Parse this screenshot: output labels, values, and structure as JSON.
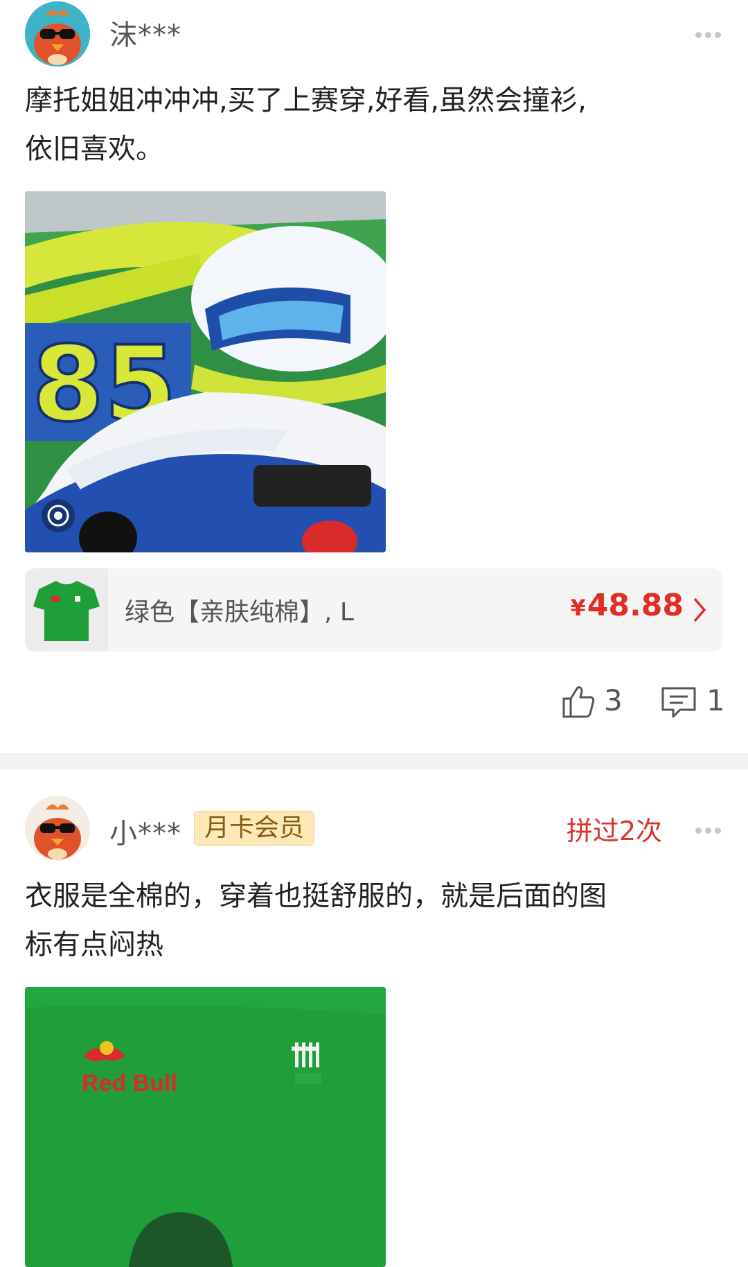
{
  "reviews": [
    {
      "username": "沫***",
      "text_line1": "摩托姐姐冲冲冲,买了上赛穿,好看,虽然会撞衫,",
      "text_line2": "依旧喜欢。",
      "photo_icon": "live-photo-icon",
      "product": {
        "spec": "绿色【亲肤纯棉】, L",
        "currency": "¥",
        "price": "48.88"
      },
      "likes": "3",
      "comments": "1"
    },
    {
      "username": "小***",
      "badge": "月卡会员",
      "group_buy": "拼过2次",
      "text_line1": "衣服是全棉的，穿着也挺舒服的，就是后面的图",
      "text_line2": "标有点闷热",
      "photo_logo_text": "Red Bull"
    }
  ],
  "colors": {
    "price_red": "#e02e24",
    "badge_bg": "#fde9b8",
    "shirt_green": "#1f9e3a"
  }
}
